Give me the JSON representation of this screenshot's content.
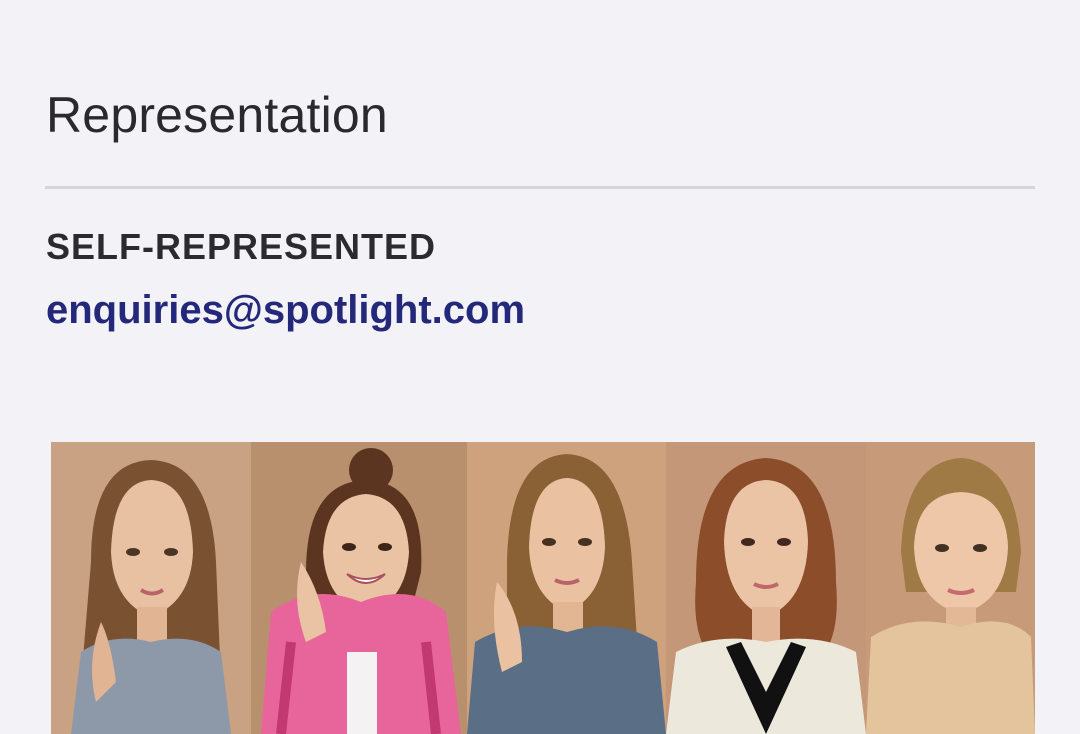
{
  "representation": {
    "heading": "Representation",
    "agent_type": "SELF-REPRESENTED",
    "email": "enquiries@spotlight.com"
  },
  "headshots": [
    {
      "name": "headshot-1",
      "top": "grey-tank",
      "colors": {
        "bg": "#c9a283",
        "hair": "#7a5232",
        "top": "#8d99a8"
      }
    },
    {
      "name": "headshot-2",
      "top": "pink-track-jacket",
      "colors": {
        "bg": "#b8906d",
        "hair": "#5c3520",
        "top": "#e8659b"
      }
    },
    {
      "name": "headshot-3",
      "top": "blue-sweater",
      "colors": {
        "bg": "#cfa27e",
        "hair": "#8a6035",
        "top": "#5a6f86"
      }
    },
    {
      "name": "headshot-4",
      "top": "cream-blazer",
      "colors": {
        "bg": "#c39777",
        "hair": "#8c4e2a",
        "top": "#ece8dc"
      }
    },
    {
      "name": "headshot-5",
      "top": "beige-shirt",
      "colors": {
        "bg": "#c79b7a",
        "hair": "#a07a45",
        "top": "#e3c49c"
      }
    }
  ]
}
